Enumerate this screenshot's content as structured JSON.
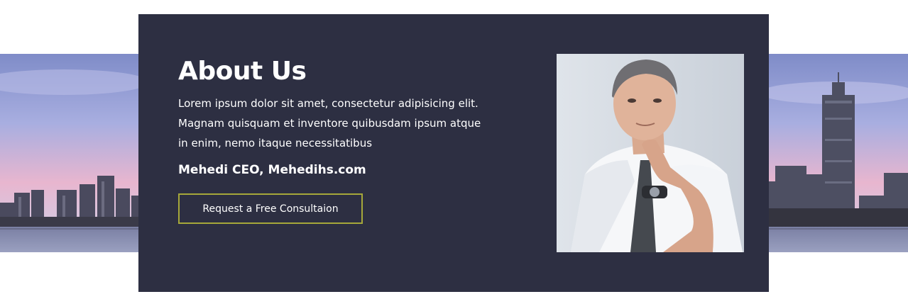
{
  "about": {
    "heading": "About Us",
    "description": "Lorem ipsum dolor sit amet, consectetur adipisicing elit. Magnam quisquam et inventore quibusdam ipsum atque in enim, nemo itaque necessitatibus",
    "author": "Mehedi CEO, Mehedihs.com",
    "cta_label": "Request a Free Consultaion"
  },
  "colors": {
    "card_background": "#2d2f42",
    "button_border": "#a6a83a",
    "text": "#ffffff",
    "page_background": "#ffffff"
  },
  "images": {
    "background": "city-skyline-photo",
    "portrait": "businessman-portrait-photo"
  }
}
